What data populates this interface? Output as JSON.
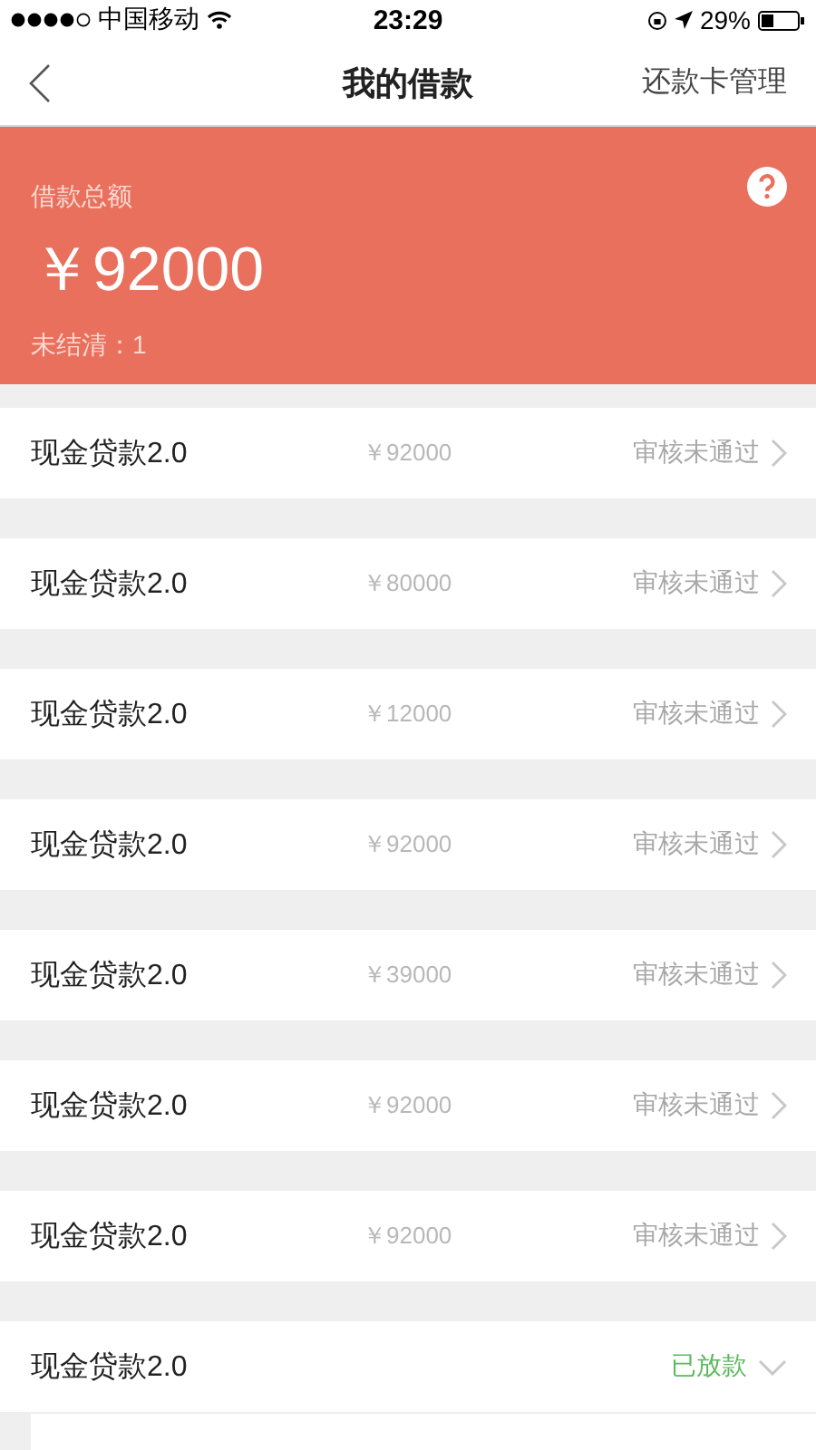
{
  "status_bar": {
    "carrier": "中国移动",
    "time": "23:29",
    "battery": "29%"
  },
  "nav": {
    "title": "我的借款",
    "action": "还款卡管理"
  },
  "summary": {
    "label": "借款总额",
    "amount": "￥92000",
    "unsettled": "未结清：1"
  },
  "loans": [
    {
      "name": "现金贷款2.0",
      "amount": "￥92000",
      "status": "审核未通过",
      "kind": "rejected",
      "expanded": false
    },
    {
      "name": "现金贷款2.0",
      "amount": "￥80000",
      "status": "审核未通过",
      "kind": "rejected",
      "expanded": false
    },
    {
      "name": "现金贷款2.0",
      "amount": "￥12000",
      "status": "审核未通过",
      "kind": "rejected",
      "expanded": false
    },
    {
      "name": "现金贷款2.0",
      "amount": "￥92000",
      "status": "审核未通过",
      "kind": "rejected",
      "expanded": false
    },
    {
      "name": "现金贷款2.0",
      "amount": "￥39000",
      "status": "审核未通过",
      "kind": "rejected",
      "expanded": false
    },
    {
      "name": "现金贷款2.0",
      "amount": "￥92000",
      "status": "审核未通过",
      "kind": "rejected",
      "expanded": false
    },
    {
      "name": "现金贷款2.0",
      "amount": "￥92000",
      "status": "审核未通过",
      "kind": "rejected",
      "expanded": false
    },
    {
      "name": "现金贷款2.0",
      "status": "已放款",
      "kind": "disbursed",
      "expanded": true
    }
  ]
}
